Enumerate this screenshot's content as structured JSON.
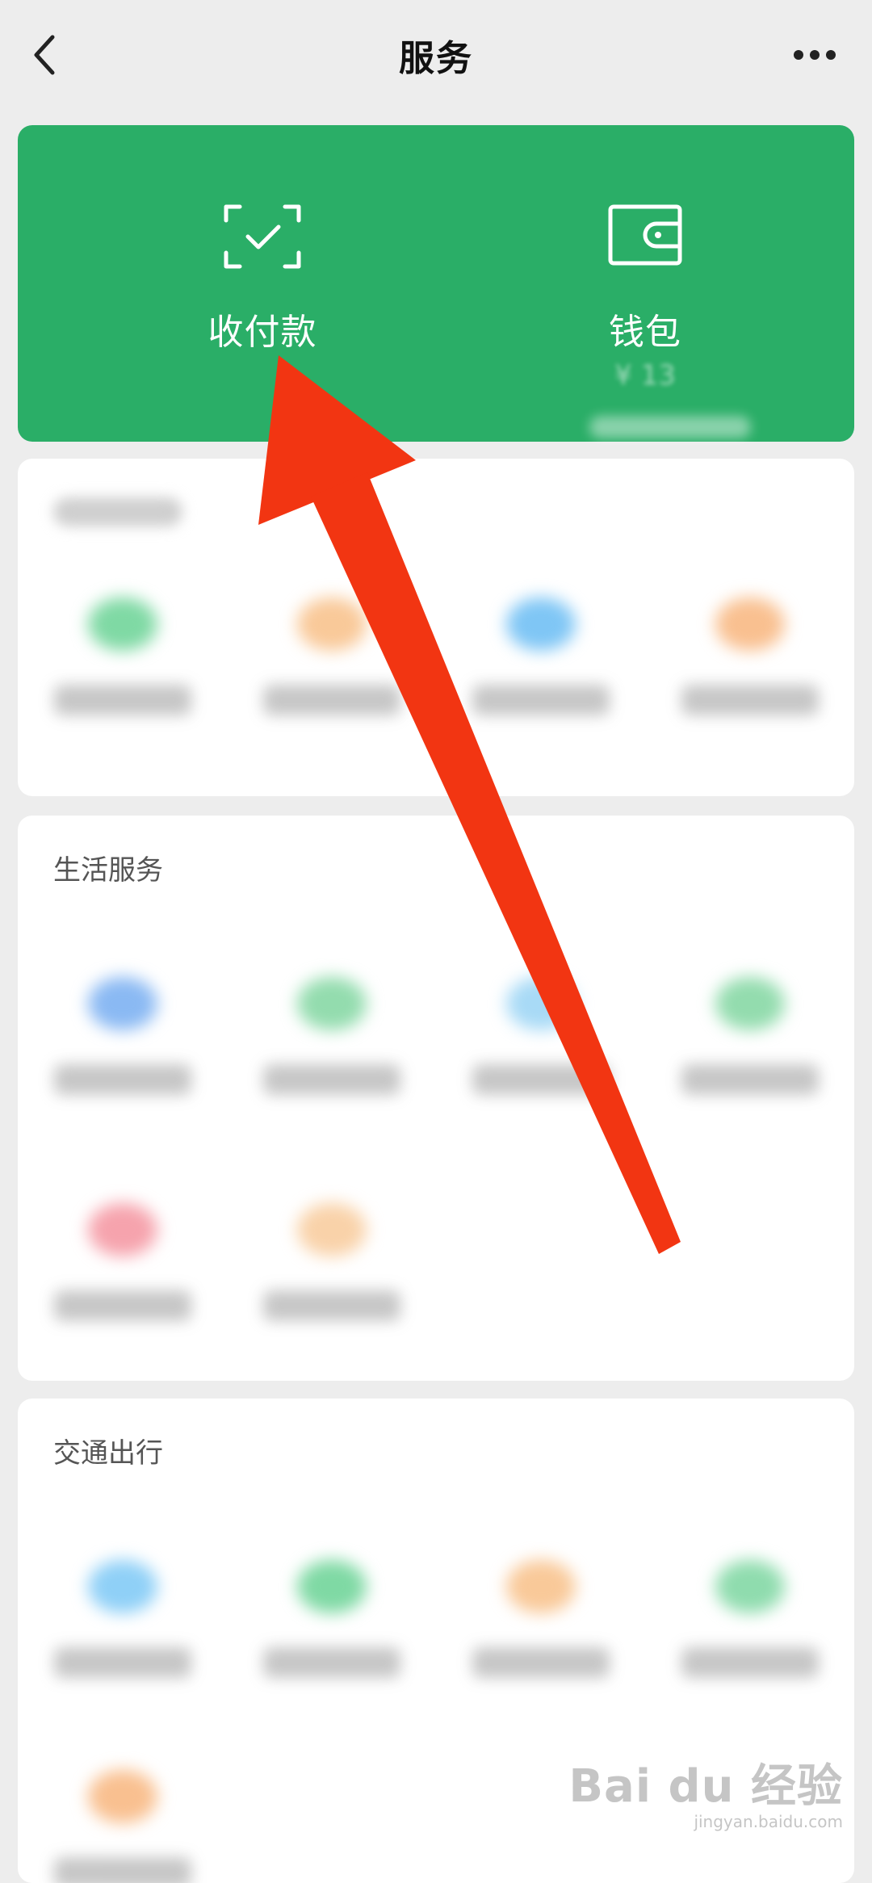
{
  "header": {
    "title": "服务"
  },
  "wallet_card": {
    "pay": {
      "label": "收付款"
    },
    "wallet": {
      "label": "钱包",
      "balance": "¥ 13"
    }
  },
  "sections": [
    {
      "title": ""
    },
    {
      "title": "生活服务"
    },
    {
      "title": "交通出行"
    }
  ],
  "watermark": {
    "main": "Bai du 经验",
    "sub": "jingyan.baidu.com"
  },
  "colors": {
    "accent_green": "#2aae67",
    "annotation_arrow": "#f23512",
    "background": "#ededed"
  }
}
